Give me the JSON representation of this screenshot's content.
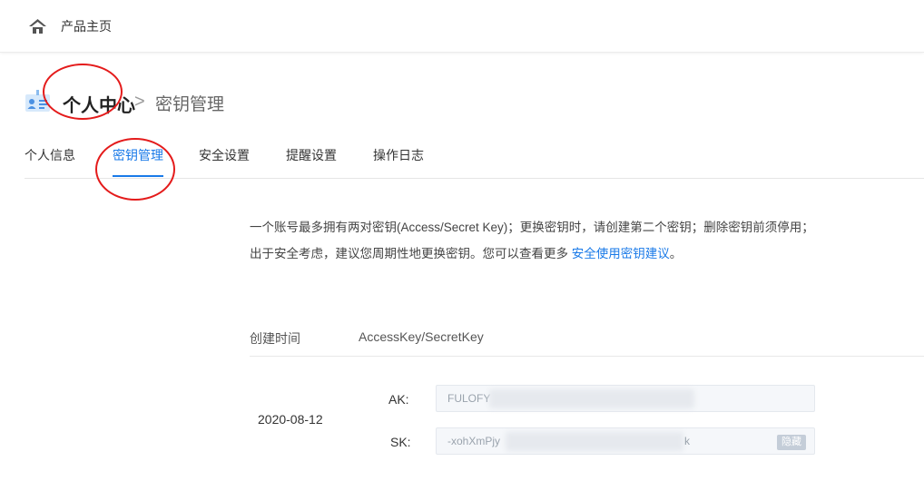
{
  "topbar": {
    "title": "产品主页",
    "icon": "home-icon"
  },
  "header": {
    "icon": "id-card-icon",
    "breadcrumb_main": "个人中心",
    "separator": ">",
    "breadcrumb_sub": "密钥管理"
  },
  "tabs": [
    {
      "label": "个人信息",
      "active": false
    },
    {
      "label": "密钥管理",
      "active": true
    },
    {
      "label": "安全设置",
      "active": false
    },
    {
      "label": "提醒设置",
      "active": false
    },
    {
      "label": "操作日志",
      "active": false
    }
  ],
  "description": {
    "text": "一个账号最多拥有两对密钥(Access/Secret Key)；更换密钥时，请创建第二个密钥；删除密钥前须停用；出于安全考虑，建议您周期性地更换密钥。您可以查看更多 ",
    "link": "安全使用密钥建议",
    "end": "。"
  },
  "table": {
    "headers": [
      "创建时间",
      "AccessKey/SecretKey"
    ],
    "rows": [
      {
        "created": "2020-08-12",
        "ak_label": "AK:",
        "ak_value": "FULOFY",
        "sk_label": "SK:",
        "sk_value_start": "-xohXmPjy",
        "sk_value_end": "k",
        "hide_label": "隐藏"
      }
    ]
  },
  "colors": {
    "accent": "#1a7ae8",
    "annotation": "#e41b1b"
  }
}
